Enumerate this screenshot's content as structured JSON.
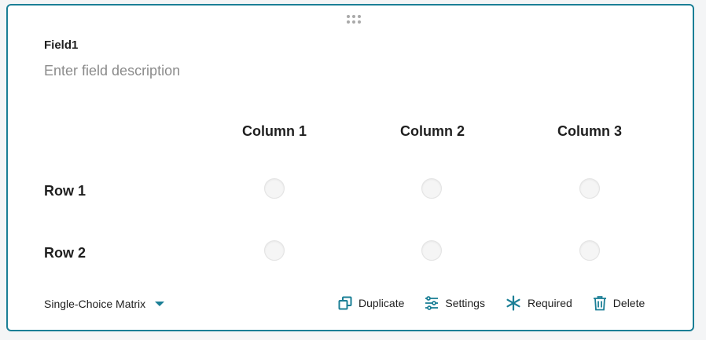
{
  "field": {
    "title": "Field1",
    "description_placeholder": "Enter field description"
  },
  "matrix": {
    "columns": [
      "Column 1",
      "Column 2",
      "Column 3"
    ],
    "rows": [
      "Row 1",
      "Row 2"
    ]
  },
  "footer": {
    "field_type": "Single-Choice Matrix",
    "actions": [
      {
        "label": "Duplicate",
        "icon": "duplicate-icon"
      },
      {
        "label": "Settings",
        "icon": "settings-sliders-icon"
      },
      {
        "label": "Required",
        "icon": "asterisk-icon"
      },
      {
        "label": "Delete",
        "icon": "trash-icon"
      }
    ]
  },
  "colors": {
    "accent": "#1b7f96",
    "border": "#1b7f96",
    "placeholder": "#8b8b8b"
  }
}
